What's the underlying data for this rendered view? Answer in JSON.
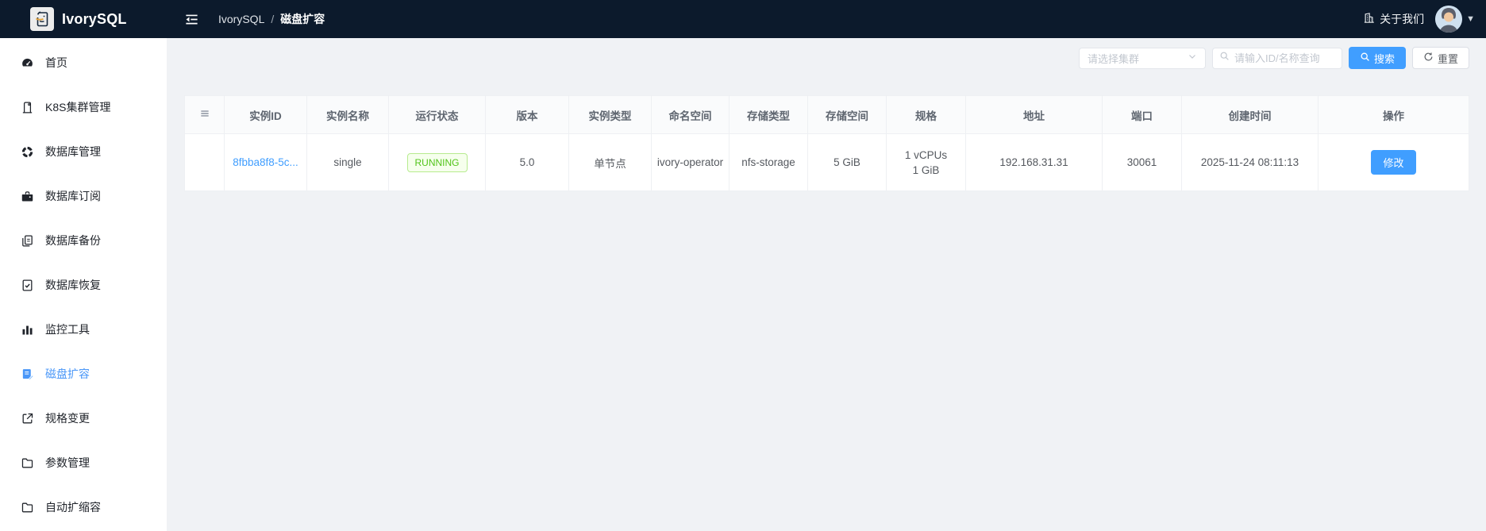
{
  "topbar": {
    "brand": "IvorySQL",
    "breadcrumb_root": "IvorySQL",
    "breadcrumb_sep": "/",
    "breadcrumb_current": "磁盘扩容",
    "about_label": "关于我们"
  },
  "sidebar": {
    "items": [
      {
        "label": "首页",
        "icon": "dashboard-icon",
        "active": false
      },
      {
        "label": "K8S集群管理",
        "icon": "cluster-icon",
        "active": false
      },
      {
        "label": "数据库管理",
        "icon": "database-manage-icon",
        "active": false
      },
      {
        "label": "数据库订阅",
        "icon": "subscription-icon",
        "active": false
      },
      {
        "label": "数据库备份",
        "icon": "backup-icon",
        "active": false
      },
      {
        "label": "数据库恢复",
        "icon": "restore-icon",
        "active": false
      },
      {
        "label": "监控工具",
        "icon": "monitor-icon",
        "active": false
      },
      {
        "label": "磁盘扩容",
        "icon": "disk-expand-icon",
        "active": true
      },
      {
        "label": "规格变更",
        "icon": "spec-change-icon",
        "active": false
      },
      {
        "label": "参数管理",
        "icon": "folder-icon",
        "active": false
      },
      {
        "label": "自动扩缩容",
        "icon": "folder-icon",
        "active": false
      }
    ]
  },
  "filters": {
    "cluster_placeholder": "请选择集群",
    "search_placeholder": "请输入ID/名称查询",
    "search_label": "搜索",
    "reset_label": "重置"
  },
  "table": {
    "columns": [
      "",
      "实例ID",
      "实例名称",
      "运行状态",
      "版本",
      "实例类型",
      "命名空间",
      "存储类型",
      "存储空间",
      "规格",
      "地址",
      "端口",
      "创建时间",
      "操作"
    ],
    "rows": [
      {
        "instance_id": "8fbba8f8-5c...",
        "instance_name": "single",
        "status": "RUNNING",
        "version": "5.0",
        "instance_type": "单节点",
        "namespace": "ivory-operator",
        "storage_type": "nfs-storage",
        "storage_size": "5 GiB",
        "spec_line1": "1 vCPUs",
        "spec_line2": "1 GiB",
        "address": "192.168.31.31",
        "port": "30061",
        "created_at": "2025-11-24 08:11:13",
        "action_label": "修改"
      }
    ]
  },
  "colors": {
    "topbar_bg": "#0c1a2c",
    "accent_blue": "#409eff",
    "active_menu_blue": "#4a97f8",
    "success_green": "#52c41a",
    "success_bg": "#f6ffed",
    "success_border": "#b7eb8f",
    "content_bg": "#f0f2f5"
  }
}
